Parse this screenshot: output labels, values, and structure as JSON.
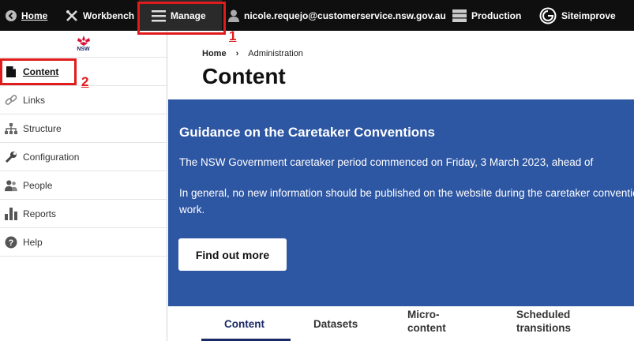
{
  "toolbar": {
    "home": "Home",
    "workbench": "Workbench",
    "manage": "Manage",
    "user": "nicole.requejo@customerservice.nsw.gov.au",
    "production": "Production",
    "siteimprove": "Siteimprove"
  },
  "brand": {
    "text": "NSW"
  },
  "annotations": {
    "one": "1",
    "two": "2"
  },
  "sidebar": {
    "items": [
      {
        "label": "Content",
        "icon": "file-icon"
      },
      {
        "label": "Links",
        "icon": "link-icon"
      },
      {
        "label": "Structure",
        "icon": "sitemap-icon"
      },
      {
        "label": "Configuration",
        "icon": "wrench-icon"
      },
      {
        "label": "People",
        "icon": "people-icon"
      },
      {
        "label": "Reports",
        "icon": "bar-chart-icon"
      },
      {
        "label": "Help",
        "icon": "help-icon"
      }
    ]
  },
  "breadcrumb": {
    "home": "Home",
    "current": "Administration"
  },
  "page": {
    "title": "Content"
  },
  "banner": {
    "title": "Guidance on the Caretaker Conventions",
    "p1": "The NSW Government caretaker period commenced on Friday, 3 March 2023, ahead of",
    "p2": "In general, no new information should be published on the website during the caretaker conventions may affect your work.",
    "button": "Find out more"
  },
  "tabs": [
    {
      "label": "Content"
    },
    {
      "label": "Datasets"
    },
    {
      "label": "Micro-\ncontent"
    },
    {
      "label": "Scheduled\ntransitions"
    }
  ],
  "colors": {
    "toolbar": "#0f0f0f",
    "banner": "#2d56a3",
    "accent": "#1a2a66",
    "annotation": "#e01b1b"
  }
}
